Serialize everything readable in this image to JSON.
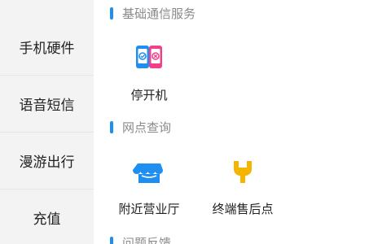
{
  "sidebar": {
    "items": [
      {
        "label": "手机硬件"
      },
      {
        "label": "语音短信"
      },
      {
        "label": "漫游出行"
      },
      {
        "label": "充值"
      }
    ]
  },
  "sections": [
    {
      "title": "基础通信服务",
      "tiles": [
        {
          "label": "停开机",
          "icon": "suspend-resume-phone-icon",
          "colors": {
            "primary": "#1e8ef0",
            "secondary": "#f0408a"
          }
        }
      ]
    },
    {
      "title": "网点查询",
      "tiles": [
        {
          "label": "附近营业厅",
          "icon": "store-icon",
          "colors": {
            "primary": "#1e8ef0"
          }
        },
        {
          "label": "终端售后点",
          "icon": "wrench-icon",
          "colors": {
            "primary": "#f5b400"
          }
        }
      ]
    },
    {
      "title": "问题反馈"
    }
  ],
  "colors": {
    "accent": "#1e8ef0",
    "sidebar_bg": "#f3f3f3",
    "section_title": "#8a8a8a"
  }
}
